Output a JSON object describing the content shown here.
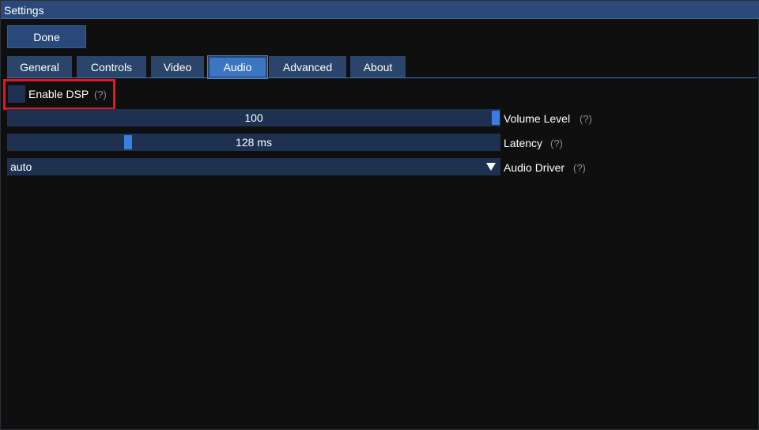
{
  "window": {
    "title": "Settings"
  },
  "toolbar": {
    "done_label": "Done"
  },
  "tabs": [
    {
      "label": "General",
      "active": false
    },
    {
      "label": "Controls",
      "active": false
    },
    {
      "label": "Video",
      "active": false
    },
    {
      "label": "Audio",
      "active": true
    },
    {
      "label": "Advanced",
      "active": false
    },
    {
      "label": "About",
      "active": false
    }
  ],
  "audio": {
    "enable_dsp": {
      "label": "Enable DSP",
      "help": "(?)",
      "checked": false
    },
    "volume": {
      "label": "Volume Level",
      "help": "(?)",
      "value_text": "100",
      "level": 1.0
    },
    "latency": {
      "label": "Latency",
      "help": "(?)",
      "value_text": "128 ms",
      "level": 0.24
    },
    "driver": {
      "label": "Audio Driver",
      "help": "(?)",
      "selected": "auto"
    }
  },
  "colors": {
    "titlebar": "#2b4a79",
    "accent": "#3c75c2",
    "control_bg": "#1e3150",
    "highlight": "#e0191f",
    "background": "#0f0f10"
  }
}
